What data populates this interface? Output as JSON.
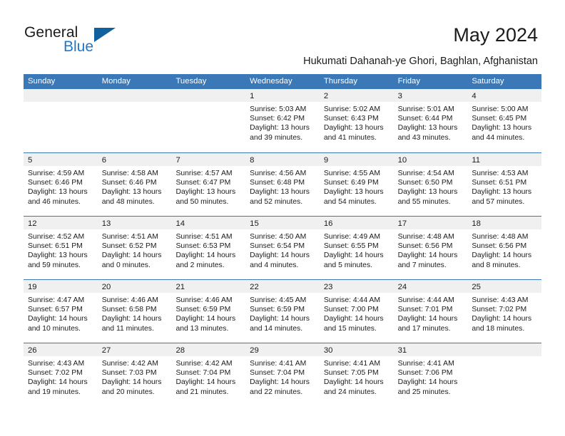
{
  "brand": {
    "word_general": "General",
    "word_blue": "Blue",
    "triangle_color": "#12619f",
    "blue_color": "#2277c8"
  },
  "header": {
    "month_title": "May 2024",
    "location": "Hukumati Dahanah-ye Ghori, Baghlan, Afghanistan"
  },
  "theme": {
    "header_blue": "#3b78b8",
    "day_band_gray": "#f0f0f0",
    "text_color": "#1b1b1b"
  },
  "weekdays": [
    "Sunday",
    "Monday",
    "Tuesday",
    "Wednesday",
    "Thursday",
    "Friday",
    "Saturday"
  ],
  "weeks": [
    [
      {
        "day": "",
        "sunrise": "",
        "sunset": "",
        "daylight_line1": "",
        "daylight_line2": "",
        "empty": true
      },
      {
        "day": "",
        "sunrise": "",
        "sunset": "",
        "daylight_line1": "",
        "daylight_line2": "",
        "empty": true
      },
      {
        "day": "",
        "sunrise": "",
        "sunset": "",
        "daylight_line1": "",
        "daylight_line2": "",
        "empty": true
      },
      {
        "day": "1",
        "sunrise": "Sunrise: 5:03 AM",
        "sunset": "Sunset: 6:42 PM",
        "daylight_line1": "Daylight: 13 hours",
        "daylight_line2": "and 39 minutes."
      },
      {
        "day": "2",
        "sunrise": "Sunrise: 5:02 AM",
        "sunset": "Sunset: 6:43 PM",
        "daylight_line1": "Daylight: 13 hours",
        "daylight_line2": "and 41 minutes."
      },
      {
        "day": "3",
        "sunrise": "Sunrise: 5:01 AM",
        "sunset": "Sunset: 6:44 PM",
        "daylight_line1": "Daylight: 13 hours",
        "daylight_line2": "and 43 minutes."
      },
      {
        "day": "4",
        "sunrise": "Sunrise: 5:00 AM",
        "sunset": "Sunset: 6:45 PM",
        "daylight_line1": "Daylight: 13 hours",
        "daylight_line2": "and 44 minutes."
      }
    ],
    [
      {
        "day": "5",
        "sunrise": "Sunrise: 4:59 AM",
        "sunset": "Sunset: 6:46 PM",
        "daylight_line1": "Daylight: 13 hours",
        "daylight_line2": "and 46 minutes."
      },
      {
        "day": "6",
        "sunrise": "Sunrise: 4:58 AM",
        "sunset": "Sunset: 6:46 PM",
        "daylight_line1": "Daylight: 13 hours",
        "daylight_line2": "and 48 minutes."
      },
      {
        "day": "7",
        "sunrise": "Sunrise: 4:57 AM",
        "sunset": "Sunset: 6:47 PM",
        "daylight_line1": "Daylight: 13 hours",
        "daylight_line2": "and 50 minutes."
      },
      {
        "day": "8",
        "sunrise": "Sunrise: 4:56 AM",
        "sunset": "Sunset: 6:48 PM",
        "daylight_line1": "Daylight: 13 hours",
        "daylight_line2": "and 52 minutes."
      },
      {
        "day": "9",
        "sunrise": "Sunrise: 4:55 AM",
        "sunset": "Sunset: 6:49 PM",
        "daylight_line1": "Daylight: 13 hours",
        "daylight_line2": "and 54 minutes."
      },
      {
        "day": "10",
        "sunrise": "Sunrise: 4:54 AM",
        "sunset": "Sunset: 6:50 PM",
        "daylight_line1": "Daylight: 13 hours",
        "daylight_line2": "and 55 minutes."
      },
      {
        "day": "11",
        "sunrise": "Sunrise: 4:53 AM",
        "sunset": "Sunset: 6:51 PM",
        "daylight_line1": "Daylight: 13 hours",
        "daylight_line2": "and 57 minutes."
      }
    ],
    [
      {
        "day": "12",
        "sunrise": "Sunrise: 4:52 AM",
        "sunset": "Sunset: 6:51 PM",
        "daylight_line1": "Daylight: 13 hours",
        "daylight_line2": "and 59 minutes."
      },
      {
        "day": "13",
        "sunrise": "Sunrise: 4:51 AM",
        "sunset": "Sunset: 6:52 PM",
        "daylight_line1": "Daylight: 14 hours",
        "daylight_line2": "and 0 minutes."
      },
      {
        "day": "14",
        "sunrise": "Sunrise: 4:51 AM",
        "sunset": "Sunset: 6:53 PM",
        "daylight_line1": "Daylight: 14 hours",
        "daylight_line2": "and 2 minutes."
      },
      {
        "day": "15",
        "sunrise": "Sunrise: 4:50 AM",
        "sunset": "Sunset: 6:54 PM",
        "daylight_line1": "Daylight: 14 hours",
        "daylight_line2": "and 4 minutes."
      },
      {
        "day": "16",
        "sunrise": "Sunrise: 4:49 AM",
        "sunset": "Sunset: 6:55 PM",
        "daylight_line1": "Daylight: 14 hours",
        "daylight_line2": "and 5 minutes."
      },
      {
        "day": "17",
        "sunrise": "Sunrise: 4:48 AM",
        "sunset": "Sunset: 6:56 PM",
        "daylight_line1": "Daylight: 14 hours",
        "daylight_line2": "and 7 minutes."
      },
      {
        "day": "18",
        "sunrise": "Sunrise: 4:48 AM",
        "sunset": "Sunset: 6:56 PM",
        "daylight_line1": "Daylight: 14 hours",
        "daylight_line2": "and 8 minutes."
      }
    ],
    [
      {
        "day": "19",
        "sunrise": "Sunrise: 4:47 AM",
        "sunset": "Sunset: 6:57 PM",
        "daylight_line1": "Daylight: 14 hours",
        "daylight_line2": "and 10 minutes."
      },
      {
        "day": "20",
        "sunrise": "Sunrise: 4:46 AM",
        "sunset": "Sunset: 6:58 PM",
        "daylight_line1": "Daylight: 14 hours",
        "daylight_line2": "and 11 minutes."
      },
      {
        "day": "21",
        "sunrise": "Sunrise: 4:46 AM",
        "sunset": "Sunset: 6:59 PM",
        "daylight_line1": "Daylight: 14 hours",
        "daylight_line2": "and 13 minutes."
      },
      {
        "day": "22",
        "sunrise": "Sunrise: 4:45 AM",
        "sunset": "Sunset: 6:59 PM",
        "daylight_line1": "Daylight: 14 hours",
        "daylight_line2": "and 14 minutes."
      },
      {
        "day": "23",
        "sunrise": "Sunrise: 4:44 AM",
        "sunset": "Sunset: 7:00 PM",
        "daylight_line1": "Daylight: 14 hours",
        "daylight_line2": "and 15 minutes."
      },
      {
        "day": "24",
        "sunrise": "Sunrise: 4:44 AM",
        "sunset": "Sunset: 7:01 PM",
        "daylight_line1": "Daylight: 14 hours",
        "daylight_line2": "and 17 minutes."
      },
      {
        "day": "25",
        "sunrise": "Sunrise: 4:43 AM",
        "sunset": "Sunset: 7:02 PM",
        "daylight_line1": "Daylight: 14 hours",
        "daylight_line2": "and 18 minutes."
      }
    ],
    [
      {
        "day": "26",
        "sunrise": "Sunrise: 4:43 AM",
        "sunset": "Sunset: 7:02 PM",
        "daylight_line1": "Daylight: 14 hours",
        "daylight_line2": "and 19 minutes."
      },
      {
        "day": "27",
        "sunrise": "Sunrise: 4:42 AM",
        "sunset": "Sunset: 7:03 PM",
        "daylight_line1": "Daylight: 14 hours",
        "daylight_line2": "and 20 minutes."
      },
      {
        "day": "28",
        "sunrise": "Sunrise: 4:42 AM",
        "sunset": "Sunset: 7:04 PM",
        "daylight_line1": "Daylight: 14 hours",
        "daylight_line2": "and 21 minutes."
      },
      {
        "day": "29",
        "sunrise": "Sunrise: 4:41 AM",
        "sunset": "Sunset: 7:04 PM",
        "daylight_line1": "Daylight: 14 hours",
        "daylight_line2": "and 22 minutes."
      },
      {
        "day": "30",
        "sunrise": "Sunrise: 4:41 AM",
        "sunset": "Sunset: 7:05 PM",
        "daylight_line1": "Daylight: 14 hours",
        "daylight_line2": "and 24 minutes."
      },
      {
        "day": "31",
        "sunrise": "Sunrise: 4:41 AM",
        "sunset": "Sunset: 7:06 PM",
        "daylight_line1": "Daylight: 14 hours",
        "daylight_line2": "and 25 minutes."
      },
      {
        "day": "",
        "sunrise": "",
        "sunset": "",
        "daylight_line1": "",
        "daylight_line2": "",
        "empty": true
      }
    ]
  ]
}
